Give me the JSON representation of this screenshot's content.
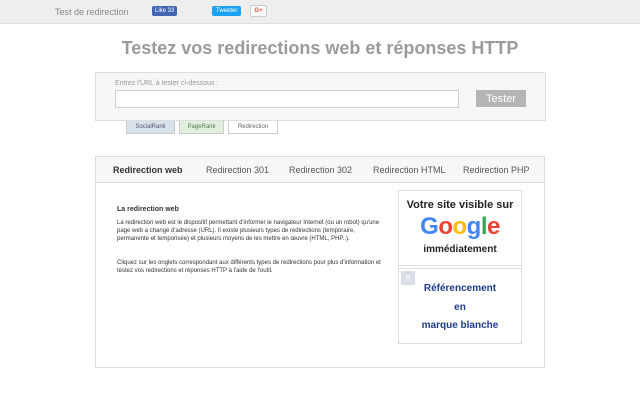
{
  "topbar": {
    "site_link": "Test de redirection",
    "fb_like": "Like 33",
    "tweet": "Tweeter",
    "gplus": "G+"
  },
  "title": "Testez vos redirections web et réponses HTTP",
  "url_form": {
    "label": "Entrez l'URL à tester ci-dessous :",
    "value": "",
    "placeholder": "",
    "button": "Tester"
  },
  "tool_tabs": [
    "SocialRank",
    "PageRank",
    "Redirection"
  ],
  "tabs": [
    "Redirection web",
    "Redirection 301",
    "Redirection 302",
    "Redirection HTML",
    "Redirection PHP"
  ],
  "content": {
    "title": "La redirection web",
    "para1": "La redirection web est le dispositif permettant d'informer le navigateur Internet (ou un robot) qu'une page web a changé d'adresse (URL). Il existe plusieurs types de redirections (temporaire, permanente et temporisée) et plusieurs moyens de les mettre en œuvre (HTML, PHP..).",
    "para2": "Cliquez sur les onglets correspondant aux différents types de redirections pour plus d'information et testez vos redirections et réponses HTTP à l'aide de l'outil."
  },
  "ads": {
    "google": {
      "line1": "Votre site visible sur",
      "logo": [
        "G",
        "o",
        "o",
        "g",
        "l",
        "e"
      ],
      "line3": "immédiatement"
    },
    "white_label": {
      "close": "✕",
      "lines": [
        "Référencement",
        "en",
        "marque blanche"
      ]
    }
  },
  "colors": {
    "google_blue": "#4285F4",
    "google_red": "#EA4335",
    "google_yellow": "#FBBC05",
    "google_green": "#34A853"
  }
}
